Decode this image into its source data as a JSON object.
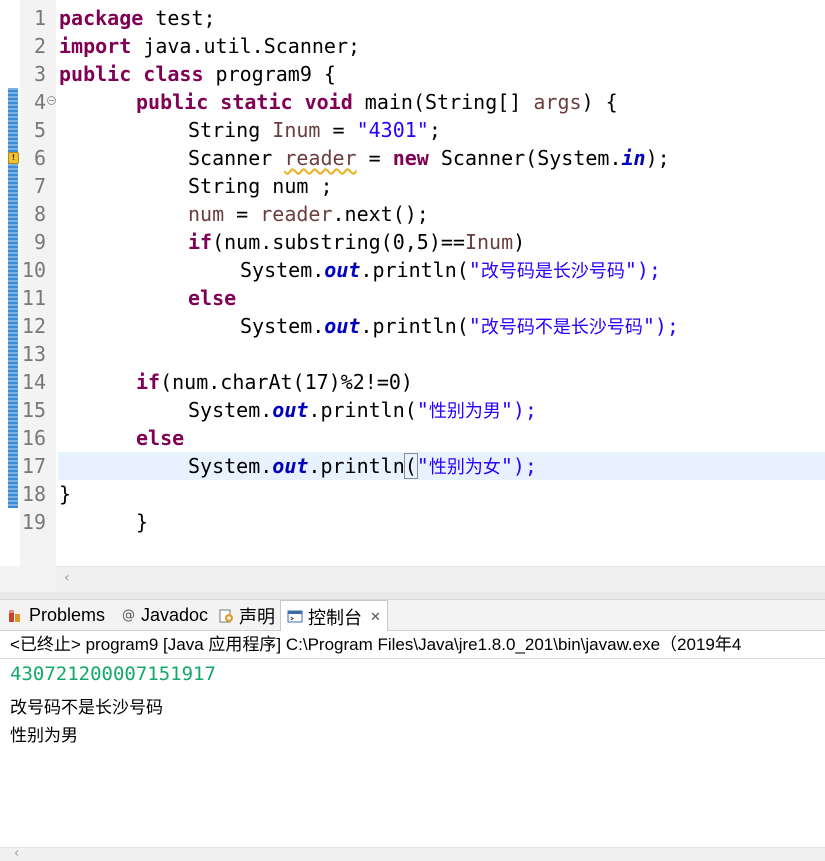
{
  "editor": {
    "lines": [
      {
        "n": "1"
      },
      {
        "n": "2"
      },
      {
        "n": "3"
      },
      {
        "n": "4"
      },
      {
        "n": "5"
      },
      {
        "n": "6"
      },
      {
        "n": "7"
      },
      {
        "n": "8"
      },
      {
        "n": "9"
      },
      {
        "n": "10"
      },
      {
        "n": "11"
      },
      {
        "n": "12"
      },
      {
        "n": "13"
      },
      {
        "n": "14"
      },
      {
        "n": "15"
      },
      {
        "n": "16"
      },
      {
        "n": "17"
      },
      {
        "n": "18"
      },
      {
        "n": "19"
      }
    ],
    "tokens": {
      "package": "package",
      "test": " test;",
      "import": "import",
      "scanner_import": " java.util.Scanner;",
      "public": "public",
      "class": "class",
      "class_name": " program9 {",
      "static": "static",
      "void": "void",
      "main_sig": " main(String[] ",
      "args": "args",
      "main_end": ") {",
      "string_type": "String ",
      "inum": "Inum",
      "assign": " = ",
      "str_4301": "\"4301\"",
      "semi": ";",
      "scanner_type": "Scanner ",
      "reader": "reader",
      "new": "new",
      "scanner_ctor": " Scanner(System.",
      "in": "in",
      "ctor_end": ");",
      "num_decl": "String num ;",
      "num": "num",
      "next_call": ".next();",
      "if": "if",
      "substr_cond": "(num.substring(0,5)==",
      "close_paren": ")",
      "system_dot": "System.",
      "out": "out",
      "println_open": ".println(",
      "println_open_noparen": ".println",
      "open_paren": "(",
      "quote": "\"",
      "msg_is_cs": "改号码是长沙号码",
      "msg_not_cs": "改号码不是长沙号码",
      "msg_male": "性别为男",
      "msg_female": "性别为女",
      "end_call": "\");",
      "else": "else",
      "charat_cond": "(num.charAt(17)%2!=0)",
      "close_brace": "}"
    }
  },
  "views": {
    "tabs": [
      {
        "label": "Problems"
      },
      {
        "label": "Javadoc"
      },
      {
        "label": "声明"
      },
      {
        "label": "控制台"
      }
    ],
    "close_glyph": "✕"
  },
  "console": {
    "header": "<已终止> program9 [Java 应用程序] C:\\Program Files\\Java\\jre1.8.0_201\\bin\\javaw.exe（2019年4",
    "input_line": "430721200007151917",
    "output": [
      "改号码不是长沙号码",
      "性别为男"
    ]
  },
  "icons": {
    "scroll_left": "‹",
    "fold": "−",
    "warn": "!",
    "javadoc": "@"
  },
  "colors": {
    "keyword": "#7f0055",
    "string": "#2a00ff",
    "field": "#0000c0",
    "console_input": "#13a86b",
    "current_line": "#e8f2fe"
  }
}
